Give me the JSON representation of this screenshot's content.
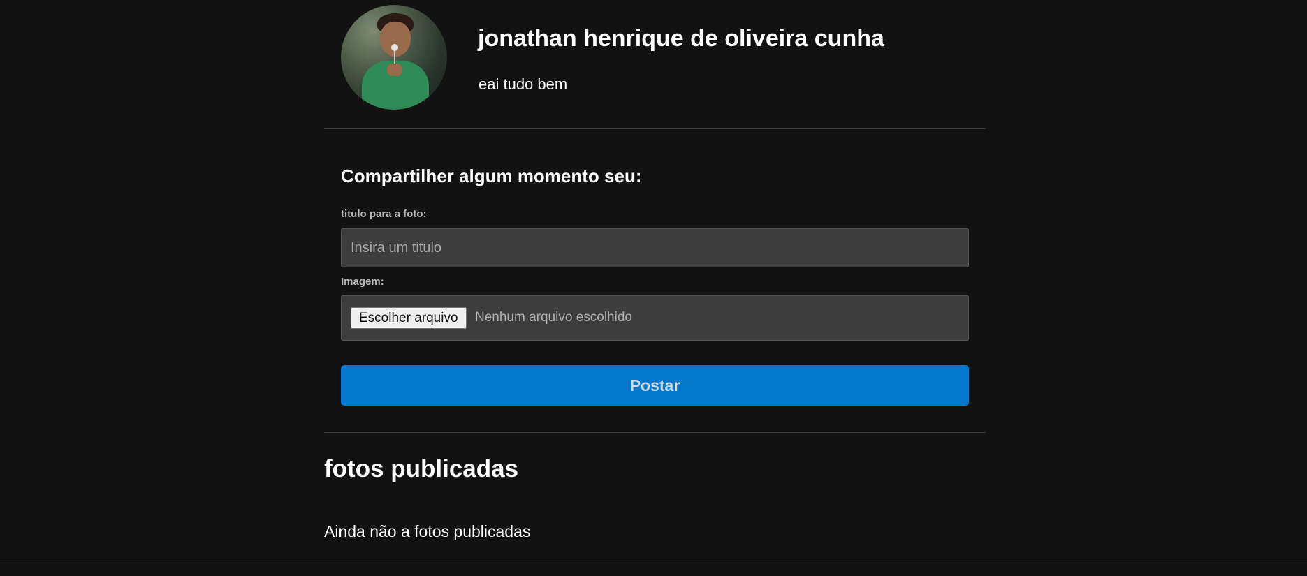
{
  "profile": {
    "name": "jonathan henrique de oliveira cunha",
    "bio": "eai tudo bem"
  },
  "share_form": {
    "heading": "Compartilher algum momento seu:",
    "title_label": "titulo para a foto:",
    "title_placeholder": "Insira um titulo",
    "title_value": "",
    "image_label": "Imagem:",
    "file_button_label": "Escolher arquivo",
    "file_status": "Nenhum arquivo escolhido",
    "submit_label": "Postar"
  },
  "gallery": {
    "heading": "fotos publicadas",
    "empty_message": "Ainda não a fotos publicadas"
  },
  "colors": {
    "background": "#121212",
    "accent": "#0577cc",
    "input_bg": "#3d3d3d"
  }
}
